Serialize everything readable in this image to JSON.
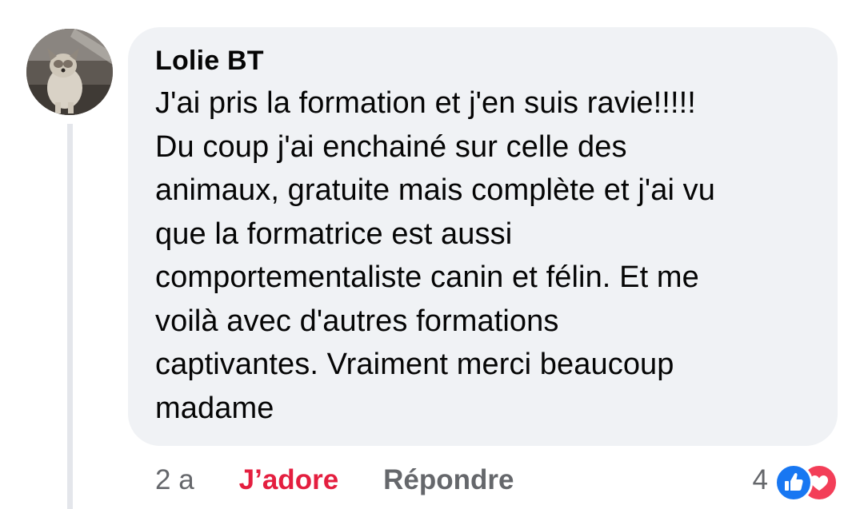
{
  "comment": {
    "author": "Lolie BT",
    "avatar_icon": "dog-photo-avatar",
    "text": "J'ai pris la formation et j'en suis ravie!!!!!\nDu coup j'ai enchainé sur celle des\nanimaux,  gratuite mais complète et j'ai vu\nque la formatrice est aussi\ncomportementaliste canin et félin. Et me\nvoilà avec d'autres formations\ncaptivantes. Vraiment merci beaucoup\nmadame"
  },
  "actions": {
    "time": "2 a",
    "love_label": "J’adore",
    "reply_label": "Répondre"
  },
  "reactions": {
    "count": "4",
    "icons": [
      "like-icon",
      "love-icon"
    ]
  },
  "colors": {
    "bubble_bg": "#f0f2f5",
    "love_red": "#e41e3f",
    "like_blue": "#1877f2",
    "meta_gray": "#65676b"
  }
}
